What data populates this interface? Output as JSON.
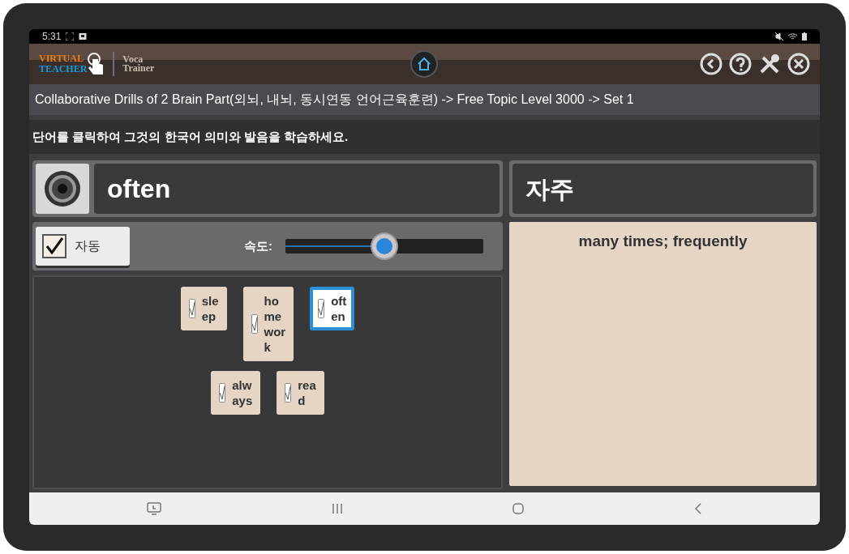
{
  "status_bar": {
    "time": "5:31"
  },
  "header": {
    "logo_line_1": "VIRTUAL",
    "logo_line_2": "TEACHER",
    "app_name_line_1": "Voca",
    "app_name_line_2": "Trainer"
  },
  "breadcrumb": "Collaborative Drills of 2 Brain Part(외뇌, 내뇌, 동시연동 언어근육훈련) -> Free Topic Level 3000 -> Set 1",
  "instruction": "단어를 클릭하여 그것의 한국어 의미와 발음을 학습하세요.",
  "word": "often",
  "auto": {
    "label": "자동",
    "checked": true
  },
  "speed": {
    "label": "속도:",
    "level": 0.5
  },
  "card_rows": [
    {
      "cards": [
        {
          "lines": [
            "sle",
            "ep"
          ],
          "selected": false
        },
        {
          "lines": [
            "ho",
            "me",
            "wor",
            "k"
          ],
          "selected": false
        },
        {
          "lines": [
            "oft",
            "en"
          ],
          "selected": true
        }
      ]
    },
    {
      "cards": [
        {
          "lines": [
            "alw",
            "ays"
          ],
          "selected": false
        },
        {
          "lines": [
            "rea",
            "d"
          ],
          "selected": false
        }
      ]
    }
  ],
  "meaning": "자주",
  "definition": "many times; frequently"
}
